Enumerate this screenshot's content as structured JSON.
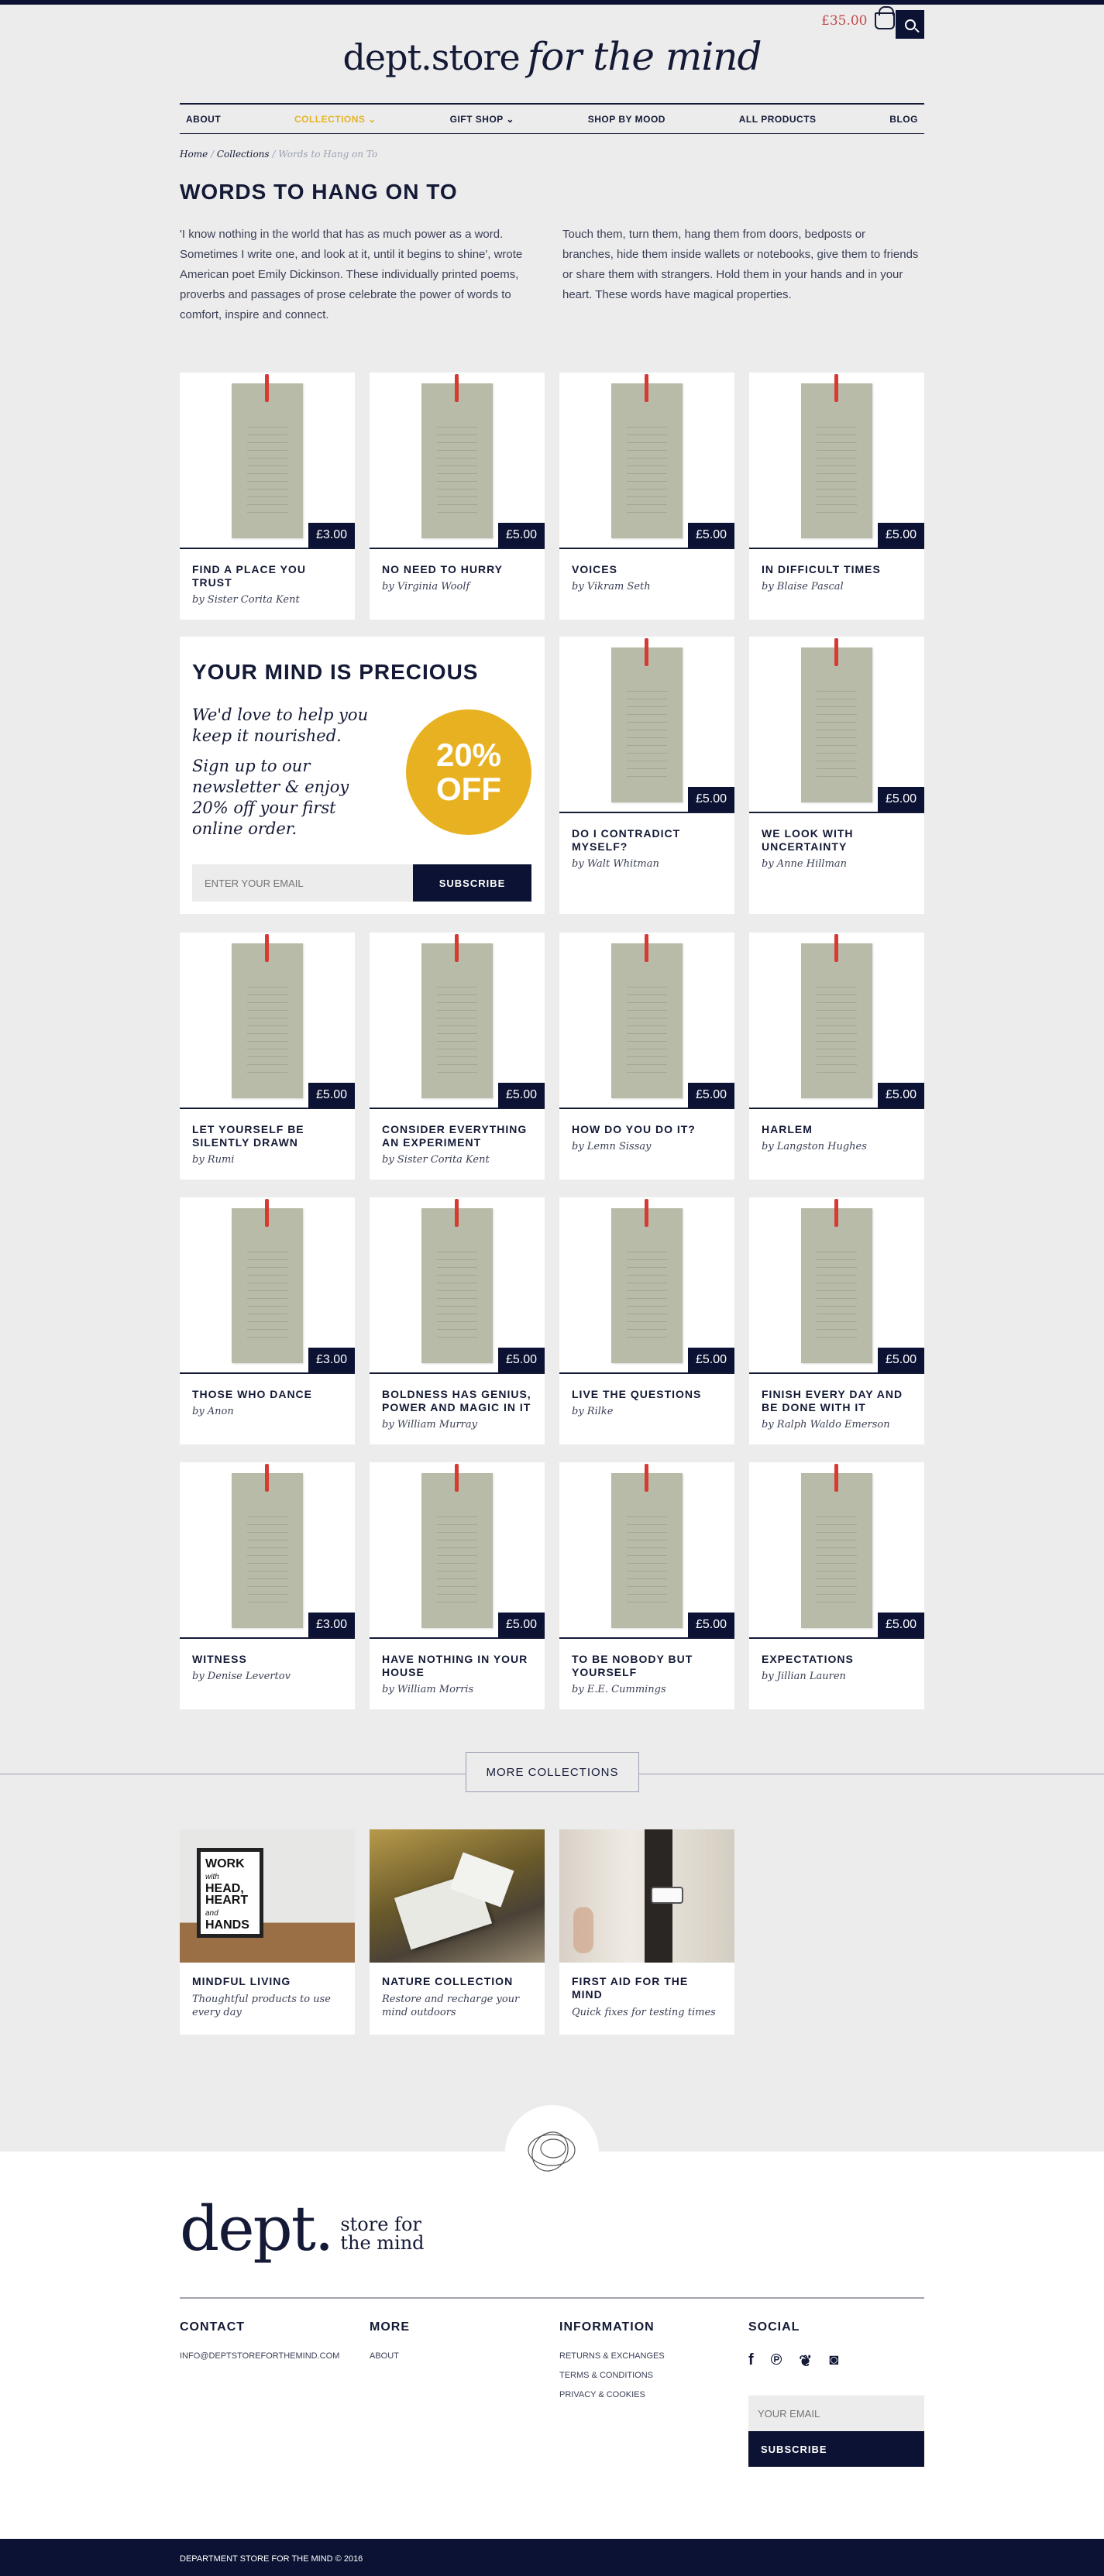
{
  "header": {
    "logo_main": "dept.store",
    "logo_italic": "for the mind",
    "cart_total": "£35.00"
  },
  "nav": [
    "ABOUT",
    "COLLECTIONS",
    "GIFT SHOP",
    "SHOP BY MOOD",
    "ALL PRODUCTS",
    "BLOG"
  ],
  "breadcrumb": {
    "home": "Home",
    "collections": "Collections",
    "current": "Words to Hang on To"
  },
  "page_title": "WORDS TO HANG ON TO",
  "intro_left": "'I know nothing in the world that has as much power as a word. Sometimes I write one, and look at it, until it begins to shine', wrote American poet Emily Dickinson. These individually printed poems, proverbs and passages of prose celebrate the power of words to comfort, inspire and connect.",
  "intro_right": "Touch them, turn them, hang them from doors, bedposts or branches, hide them inside wallets or notebooks, give them to friends or share them with strangers. Hold them in your hands and in your heart. These words have magical properties.",
  "products": [
    {
      "name": "FIND A PLACE YOU TRUST",
      "author": "by Sister Corita Kent",
      "price": "£3.00"
    },
    {
      "name": "NO NEED TO HURRY",
      "author": "by Virginia Woolf",
      "price": "£5.00"
    },
    {
      "name": "VOICES",
      "author": "by Vikram Seth",
      "price": "£5.00"
    },
    {
      "name": "IN DIFFICULT TIMES",
      "author": "by Blaise Pascal",
      "price": "£5.00"
    },
    {
      "name": "DO I CONTRADICT MYSELF?",
      "author": "by Walt Whitman",
      "price": "£5.00"
    },
    {
      "name": "WE LOOK WITH UNCERTAINTY",
      "author": "by Anne Hillman",
      "price": "£5.00"
    },
    {
      "name": "LET YOURSELF BE SILENTLY DRAWN",
      "author": "by Rumi",
      "price": "£5.00"
    },
    {
      "name": "CONSIDER EVERYTHING AN EXPERIMENT",
      "author": "by Sister Corita Kent",
      "price": "£5.00"
    },
    {
      "name": "HOW DO YOU DO IT?",
      "author": "by Lemn Sissay",
      "price": "£5.00"
    },
    {
      "name": "HARLEM",
      "author": "by Langston Hughes",
      "price": "£5.00"
    },
    {
      "name": "THOSE WHO DANCE",
      "author": "by Anon",
      "price": "£3.00"
    },
    {
      "name": "BOLDNESS HAS GENIUS, POWER AND MAGIC IN IT",
      "author": "by William Murray",
      "price": "£5.00"
    },
    {
      "name": "LIVE THE QUESTIONS",
      "author": "by Rilke",
      "price": "£5.00"
    },
    {
      "name": "FINISH EVERY DAY AND BE DONE WITH IT",
      "author": "by Ralph Waldo Emerson",
      "price": "£5.00"
    },
    {
      "name": "WITNESS",
      "author": "by Denise Levertov",
      "price": "£3.00"
    },
    {
      "name": "HAVE NOTHING IN YOUR HOUSE",
      "author": "by William Morris",
      "price": "£5.00"
    },
    {
      "name": "TO BE NOBODY BUT YOURSELF",
      "author": "by E.E. Cummings",
      "price": "£5.00"
    },
    {
      "name": "EXPECTATIONS",
      "author": "by Jillian Lauren",
      "price": "£5.00"
    }
  ],
  "promo": {
    "title": "YOUR MIND IS PRECIOUS",
    "lead1": "We'd love to help you keep it nourished.",
    "lead2": "Sign up to our newsletter & enjoy 20% off your first online order.",
    "badge_top": "20%",
    "badge_bottom": "OFF",
    "email_placeholder": "ENTER YOUR EMAIL",
    "button": "SUBSCRIBE"
  },
  "more_collections": "MORE COLLECTIONS",
  "collections": [
    {
      "name": "MINDFUL LIVING",
      "desc": "Thoughtful products to use every day",
      "poster": [
        "WORK",
        "with",
        "HEAD,",
        "HEART",
        "and",
        "HANDS"
      ]
    },
    {
      "name": "NATURE COLLECTION",
      "desc": "Restore and recharge your mind outdoors"
    },
    {
      "name": "FIRST AID FOR THE MIND",
      "desc": "Quick fixes for testing times"
    }
  ],
  "footer": {
    "logo_big": "dept.",
    "logo_small1": "store for",
    "logo_small2": "the mind",
    "contact_title": "CONTACT",
    "contact_email": "INFO@DEPTSTOREFORTHEMIND.COM",
    "more_title": "MORE",
    "more_links": [
      "ABOUT"
    ],
    "info_title": "INFORMATION",
    "info_links": [
      "RETURNS & EXCHANGES",
      "TERMS & CONDITIONS",
      "PRIVACY & COOKIES"
    ],
    "social_title": "SOCIAL",
    "social_icons": [
      "facebook-icon",
      "pinterest-icon",
      "twitter-icon",
      "instagram-icon"
    ],
    "email_placeholder": "YOUR EMAIL",
    "subscribe": "SUBSCRIBE",
    "copyright": "DEPARTMENT STORE FOR THE MIND © 2016"
  },
  "colors": {
    "navy": "#0c1233",
    "accent_yellow": "#e8b121",
    "tag_grey": "#b8bba8",
    "tag_string": "#d83a32",
    "cart_red": "#c24a4a"
  }
}
